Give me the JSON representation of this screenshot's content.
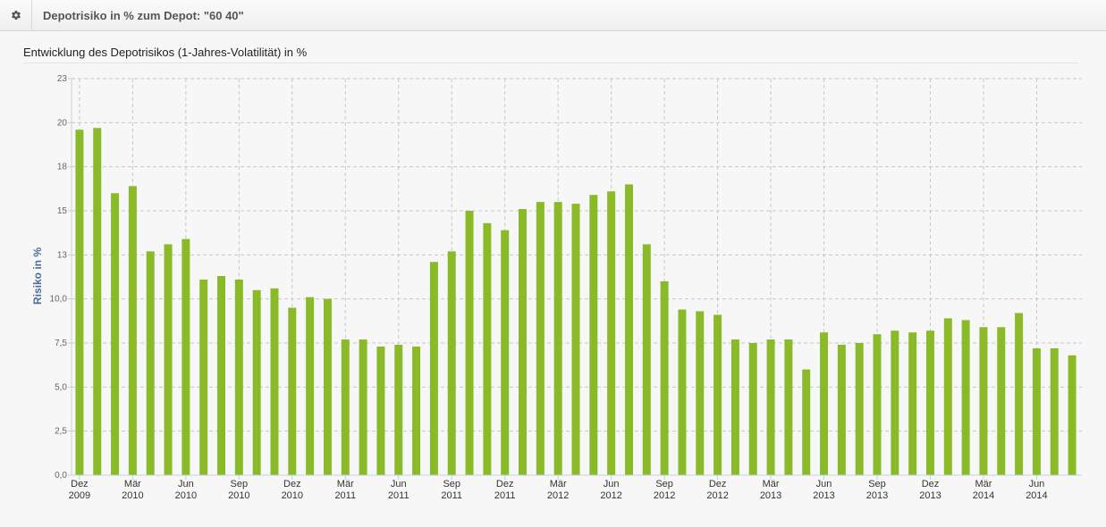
{
  "header": {
    "title": "Depotrisiko in % zum Depot: \"60 40\"",
    "icon": "gear-icon"
  },
  "chart_data": {
    "type": "bar",
    "title": "Entwicklung des Depotrisikos (1-Jahres-Volatilität) in %",
    "ylabel": "Risiko in %",
    "xlabel": "",
    "ylim": [
      0,
      22.5
    ],
    "yticks": [
      {
        "value": 0,
        "label": "0,0"
      },
      {
        "value": 2.5,
        "label": "2,5"
      },
      {
        "value": 5,
        "label": "5,0"
      },
      {
        "value": 7.5,
        "label": "7,5"
      },
      {
        "value": 10,
        "label": "10,0"
      },
      {
        "value": 12.5,
        "label": "13"
      },
      {
        "value": 15,
        "label": "15"
      },
      {
        "value": 17.5,
        "label": "18"
      },
      {
        "value": 20,
        "label": "20"
      },
      {
        "value": 22.5,
        "label": "23"
      }
    ],
    "xticks": [
      {
        "index": 0,
        "label": [
          "Dez",
          "2009"
        ]
      },
      {
        "index": 3,
        "label": [
          "Mär",
          "2010"
        ]
      },
      {
        "index": 6,
        "label": [
          "Jun",
          "2010"
        ]
      },
      {
        "index": 9,
        "label": [
          "Sep",
          "2010"
        ]
      },
      {
        "index": 12,
        "label": [
          "Dez",
          "2010"
        ]
      },
      {
        "index": 15,
        "label": [
          "Mär",
          "2011"
        ]
      },
      {
        "index": 18,
        "label": [
          "Jun",
          "2011"
        ]
      },
      {
        "index": 21,
        "label": [
          "Sep",
          "2011"
        ]
      },
      {
        "index": 24,
        "label": [
          "Dez",
          "2011"
        ]
      },
      {
        "index": 27,
        "label": [
          "Mär",
          "2012"
        ]
      },
      {
        "index": 30,
        "label": [
          "Jun",
          "2012"
        ]
      },
      {
        "index": 33,
        "label": [
          "Sep",
          "2012"
        ]
      },
      {
        "index": 36,
        "label": [
          "Dez",
          "2012"
        ]
      },
      {
        "index": 39,
        "label": [
          "Mär",
          "2013"
        ]
      },
      {
        "index": 42,
        "label": [
          "Jun",
          "2013"
        ]
      },
      {
        "index": 45,
        "label": [
          "Sep",
          "2013"
        ]
      },
      {
        "index": 48,
        "label": [
          "Dez",
          "2013"
        ]
      },
      {
        "index": 51,
        "label": [
          "Mär",
          "2014"
        ]
      },
      {
        "index": 54,
        "label": [
          "Jun",
          "2014"
        ]
      }
    ],
    "values": [
      19.6,
      19.7,
      16.0,
      16.4,
      12.7,
      13.1,
      13.4,
      11.1,
      11.3,
      11.1,
      10.5,
      10.6,
      9.5,
      10.1,
      10.0,
      7.7,
      7.7,
      7.3,
      7.4,
      7.3,
      12.1,
      12.7,
      15.0,
      14.3,
      13.9,
      15.1,
      15.5,
      15.5,
      15.4,
      15.9,
      16.1,
      16.5,
      13.1,
      11.0,
      9.4,
      9.3,
      9.1,
      7.7,
      7.5,
      7.7,
      7.7,
      6.0,
      8.1,
      7.4,
      7.5,
      8.0,
      8.2,
      8.1,
      8.2,
      8.9,
      8.8,
      8.4,
      8.4,
      9.2,
      7.2,
      7.2,
      6.8
    ],
    "bar_color": "#8aba28",
    "grid": true,
    "legend": "none"
  }
}
